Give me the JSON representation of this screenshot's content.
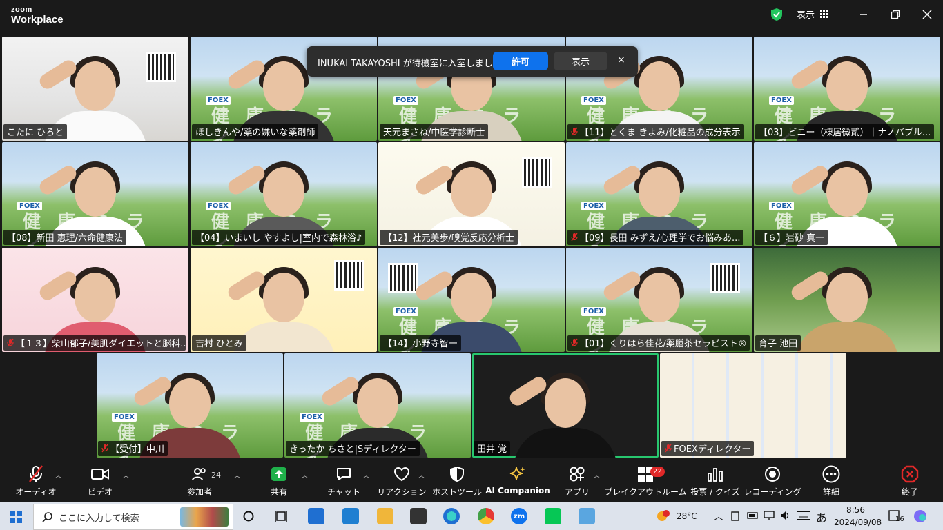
{
  "titlebar": {
    "logo_top": "zoom",
    "logo_bottom": "Workplace",
    "view_label": "表示"
  },
  "notification": {
    "message": "INUKAI TAKAYOSHI が待機室に入室しました",
    "allow_label": "許可",
    "show_label": "表示",
    "close_glyph": "×"
  },
  "participants": [
    {
      "name": "こたに ひろと",
      "muted": false
    },
    {
      "name": "ほしきんや/薬の嫌いな薬剤師",
      "muted": false
    },
    {
      "name": "天元まさね/中医学診断士",
      "muted": false
    },
    {
      "name": "【11】とくま きよみ/化粧品の成分表示",
      "muted": true
    },
    {
      "name": "【03】ビニー（棟居微貳）｜ナノバブル...",
      "muted": false
    },
    {
      "name": "【08】新田 恵理/六命健康法",
      "muted": false
    },
    {
      "name": "【04】いまいし やすよし|室内で森林浴♪",
      "muted": false
    },
    {
      "name": "【12】社元美歩/嗅覚反応分析士",
      "muted": false
    },
    {
      "name": "【09】長田 みずえ/心理学でお悩みあ...",
      "muted": true
    },
    {
      "name": "【６】岩砂 真一",
      "muted": false
    },
    {
      "name": "【１３】柴山郁子/美肌ダイエットと脳科...",
      "muted": true
    },
    {
      "name": "吉村 ひとみ",
      "muted": false
    },
    {
      "name": "【14】小野寺智一",
      "muted": false
    },
    {
      "name": "【01】くりはら佳花/薬膳茶セラピスト®",
      "muted": true
    },
    {
      "name": "育子 池田",
      "muted": false
    },
    {
      "name": "【受付】中川",
      "muted": true
    },
    {
      "name": "きったか ちさと|Sディレクター",
      "muted": false
    },
    {
      "name": "田井 覚",
      "muted": false
    },
    {
      "name": "FOEXディレクター",
      "muted": true
    }
  ],
  "tile_text": {
    "kenko": "健康ミライ",
    "foex": "FOEX"
  },
  "toolbar": {
    "audio": "オーディオ",
    "video": "ビデオ",
    "participants": "参加者",
    "participants_count": "24",
    "share": "共有",
    "chat": "チャット",
    "reactions": "リアクション",
    "host_tools": "ホストツール",
    "ai_companion": "AI Companion",
    "apps": "アプリ",
    "breakout": "ブレイクアウトルーム",
    "breakout_badge": "22",
    "polls": "投票 / クイズ",
    "recording": "レコーディング",
    "more": "詳細",
    "end": "終了"
  },
  "taskbar": {
    "search_placeholder": "ここに入力して検索",
    "weather": "28°C",
    "ime": "あ",
    "time": "8:56",
    "date": "2024/09/08",
    "notifications": "16"
  },
  "colors": {
    "accent": "#0e72ed",
    "active_speaker": "#28c76f",
    "end": "#e02828",
    "share": "#1fb04a"
  }
}
